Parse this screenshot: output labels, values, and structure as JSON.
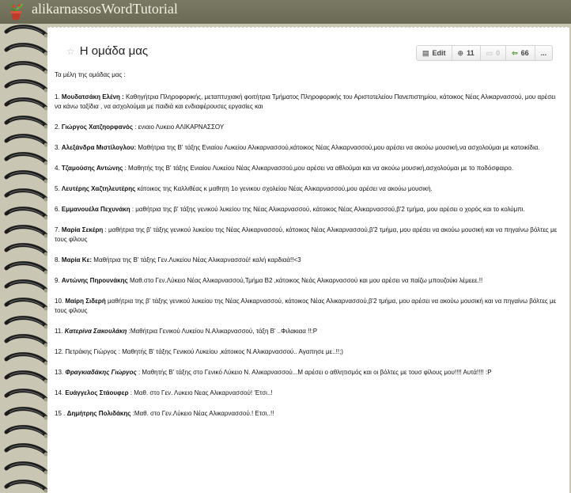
{
  "site": {
    "title": "alikarnassosWordTutorial",
    "logo_icon": "potted-plant-icon"
  },
  "page": {
    "title": "Η ομάδα μας",
    "star_icon": "star-icon"
  },
  "toolbar": {
    "edit_label": "Edit",
    "views_count": "11",
    "comments_count": "0",
    "revisions_count": "66",
    "more_label": "..."
  },
  "content": {
    "intro": "Τα μέλη της ομάδας μας :",
    "members": [
      {
        "num": "1.",
        "name": "Μουδατσάκη Ελένη :",
        "text": "Καθηγήτρια Πληροφορικής, μεταπτυχιακή φοιτήτρια Τμήματος Πληροφορικής του Αριστοτελείου Πανεπιστημίου, κάτοικος Νέας Αλικαρνασσού, μου αρέσει να κάνω ταξίδια , να ασχολούμαι με παιδιά και ενδιαφέρουσες εργασίες και"
      },
      {
        "num": "2.",
        "name": "Γιώργος Χατζηορφανός",
        "text": ": ενιαιο Λυκειο ΑΛΙΚΑΡΝΑΣΣΟΥ"
      },
      {
        "num": "3.",
        "name": "Αλεξάνδρα Μιστίλογλου:",
        "text": "Μαθήτρια της Β' τάξης Ενιαίου Λυκείου Αλικαρνασσού,κάτοικος Νέας Αλικαρνασσού,μου αρέσει να ακούω μουσική,να ασχολούμαι με κατοικίδια."
      },
      {
        "num": "4.",
        "name": "Τζαμούσης Αντώνης",
        "text": ": Μαθητής της Β' τάξης Ενιαίου Λυκείου Νέας Αλικαρνασσού,μου αρέσει να αθλούμαι και να ακούω μουσική,ασχολούμαι με το ποδόσφαιρο."
      },
      {
        "num": "5.",
        "name": "Λευτέρης Χαζτηλευτέρης",
        "text": "κάτοικος της Καλλιθέας κ μαθητη 1ο γενικου σχολείου Νέας Αλικαρνασσού,μου αρέσει να ακούω μουσική."
      },
      {
        "num": "6.",
        "name": "Εμμανουέλα Πεχυνάκη",
        "text": ": μαθήτρια της β' τάξης γενικού λυκείου της Νέας Αλικαρνασσού, κάτοικος Νέας Αλικαρνασσού,β'2 τμήμα, μου αρέσει ο χορός και το κολύμπι."
      },
      {
        "num": "7.",
        "name": "Μαρία Σεκέρη",
        "text": ": μαθήτρια της β' τάξης γενικού λυκείου της Νέας Αλικαρνασσού, κάτοικος Νέας Αλικαρνασσού,β'2 τμήμα, μου αρέσει να ακούω μουσική και να πηγαίνω βόλτες με τους φίλους"
      },
      {
        "num": "8.",
        "name": "Μαρία Κε:",
        "text": "Μαθήτρια της Β' τάξης Γεν.Λυκείου Νέας Αλικαρνασσού! καλή καρδιαά!!<3"
      },
      {
        "num": "9.",
        "name": "Αντώνης Πηρουνάκης",
        "text": "Μαθ.στο Γεν.Λύκειο Νέας Αλικαρνασσού,Τμήμα Β2 ,κάτοικος Νεάς Αλικαρνασσού και μου αρέσει να παίζω μπουζούκι λέμεεε.!!"
      },
      {
        "num": "10.",
        "name": "Μαίρη Σιδερή",
        "text": "μαθήτρια της β' τάξης γενικού λυκείου της Νέας Αλικαρνασσού, κάτοικος Νέας Αλικαρνασσού,β'2 τμήμα, μου αρέσει να ακούω μουσική και να πηγαίνω βόλτες με τους φίλους"
      },
      {
        "num": "11.",
        "name": "Κατερίνα Σακουλάκη",
        "text": ":Μαθήτρια Γενικού Λυκείου Ν.Αλικαρνασσού, τάξη Β' ..Φιλακιαα !!:P",
        "italic": true
      },
      {
        "num": "12.",
        "name": "Πετράκης Γιώργος",
        "text": ": Μαθητής Β' τάξης Γενικού Λυκείου ,κάτοικος Ν.Αλικαρνασσού.. Αγαπησε με..!!;)",
        "plain": true
      },
      {
        "num": "13.",
        "name": "Φραγκιαδάκης Γιώργος",
        "text": ": Μαθητής Β' τάξης στο Γενικό Λύκειο Ν. Αλικαρνασσού...Μ αρέσει ο αθλητισμός και οι βόλτες με τουσ φίλους μου!!!! Αυτά!!!! :P",
        "italic": true
      },
      {
        "num": "14.",
        "name": "Ευάγγελος Στάουφερ",
        "text": ": Μαθ. στο Γεν. Λυκειο Νεας Αλικαρνασσού! 'Ετσι..!"
      },
      {
        "num": "15 .",
        "name": "Δημήτρης Πολιδάκης",
        "text": ":Μαθ. στο Γεν.Λύκειο Νέας Αλικαρνασσού.! Ετσι..!!"
      }
    ]
  }
}
